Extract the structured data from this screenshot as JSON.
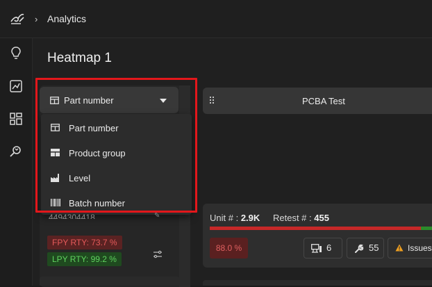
{
  "breadcrumb": {
    "current": "Analytics"
  },
  "page": {
    "title": "Heatmap 1"
  },
  "sidebar": {
    "icons": [
      "lightbulb-icon",
      "chart-icon",
      "dashboard-icon",
      "search-refresh-icon"
    ]
  },
  "groupby": {
    "selected": "Part number",
    "options": [
      {
        "label": "Part number",
        "icon": "table-icon"
      },
      {
        "label": "Product group",
        "icon": "grid-icon"
      },
      {
        "label": "Level",
        "icon": "factory-icon"
      },
      {
        "label": "Batch number",
        "icon": "barcode-icon"
      }
    ]
  },
  "left_row": {
    "serial": "4494304418",
    "fpy": "FPY RTY: 73.7 %",
    "lpy": "LPY RTY: 99.2 %"
  },
  "column": {
    "title": "PCBA Test"
  },
  "card": {
    "unit_label": "Unit # :",
    "unit_value": "2.9K",
    "retest_label": "Retest # :",
    "retest_value": "455",
    "fail_fraction": 0.92,
    "yield": "88.0 %",
    "stations": "6",
    "repairs": "55",
    "issues_label": "Issues"
  },
  "colors": {
    "accent_red": "#e3171b",
    "fail": "#c62828",
    "pass": "#2b8a2b"
  }
}
